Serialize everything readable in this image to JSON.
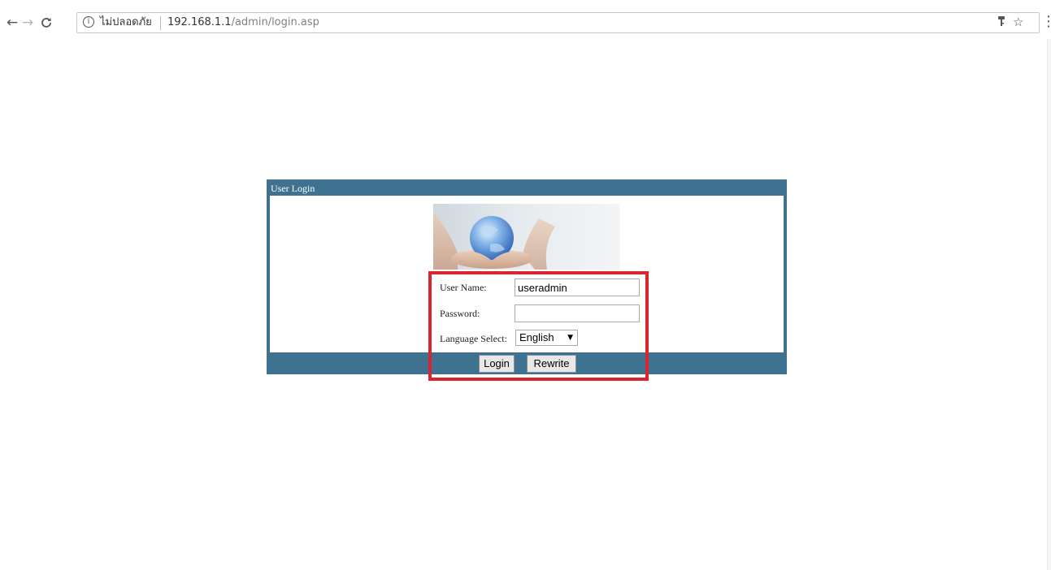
{
  "browser": {
    "back_icon": "←",
    "forward_icon": "→",
    "reload_icon": "C",
    "info_icon": "i",
    "security_label": "ไม่ปลอดภัย",
    "url_host": "192.168.1.1",
    "url_path": "/admin/login.asp",
    "key_icon": "key-icon",
    "star_icon": "☆",
    "menu_icon": "⋮"
  },
  "login": {
    "panel_title": "User Login",
    "username_label": "User Name:",
    "username_value": "useradmin",
    "password_label": "Password:",
    "password_value": "",
    "language_label": "Language Select:",
    "language_value": "English",
    "login_button": "Login",
    "rewrite_button": "Rewrite"
  },
  "colors": {
    "panel_header": "#3f7291",
    "highlight": "#d9262e"
  }
}
